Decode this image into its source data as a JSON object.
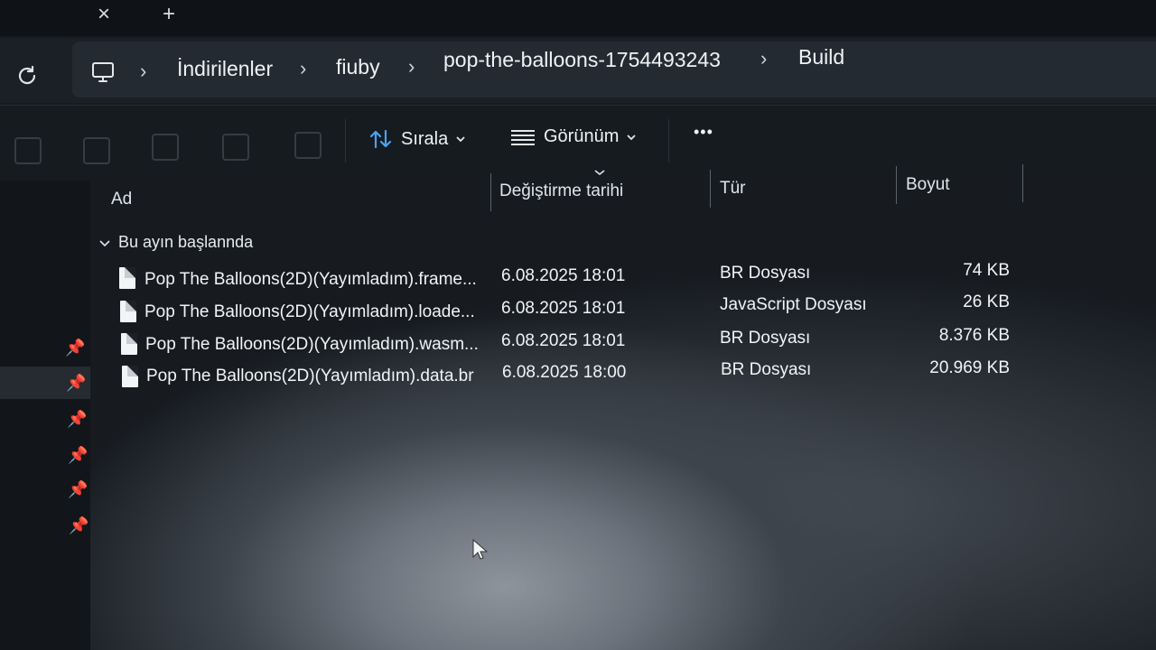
{
  "tabs": {
    "close_symbol": "×",
    "new_tab_symbol": "+"
  },
  "address": {
    "crumbs": [
      "İndirilenler",
      "fiuby",
      "pop-the-balloons-1754493243",
      "Build"
    ],
    "separator": "›"
  },
  "toolbar": {
    "sort_label": "Sırala",
    "view_label": "Görünüm",
    "more_label": "•••"
  },
  "columns": {
    "name": "Ad",
    "modified": "Değiştirme tarihi",
    "type": "Tür",
    "size": "Boyut"
  },
  "group": {
    "label": "Bu ayın başlannda"
  },
  "files": [
    {
      "name": "Pop The Balloons(2D)(Yayımladım).frame...",
      "modified": "6.08.2025 18:01",
      "type": "BR Dosyası",
      "size": "74 KB",
      "icon": "file-icon"
    },
    {
      "name": "Pop The Balloons(2D)(Yayımladım).loade...",
      "modified": "6.08.2025 18:01",
      "type": "JavaScript Dosyası",
      "size": "26 KB",
      "icon": "js-file-icon"
    },
    {
      "name": "Pop The Balloons(2D)(Yayımladım).wasm...",
      "modified": "6.08.2025 18:01",
      "type": "BR Dosyası",
      "size": "8.376 KB",
      "icon": "file-icon"
    },
    {
      "name": "Pop The Balloons(2D)(Yayımladım).data.br",
      "modified": "6.08.2025 18:00",
      "type": "BR Dosyası",
      "size": "20.969 KB",
      "icon": "file-icon"
    }
  ],
  "nav": {
    "pins": [
      "pin-icon",
      "pin-icon",
      "pin-icon",
      "pin-icon",
      "pin-icon",
      "pin-icon"
    ]
  },
  "colors": {
    "accent_sort": "#4aa3f0",
    "window_bg": "#171b20"
  }
}
